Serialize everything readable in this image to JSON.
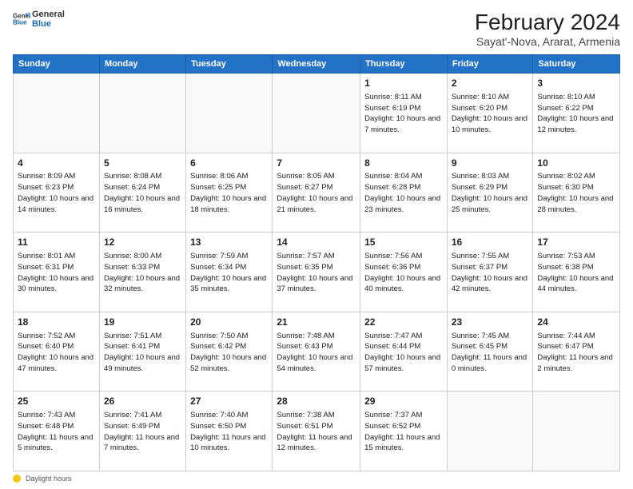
{
  "logo": {
    "general": "General",
    "blue": "Blue"
  },
  "header": {
    "month_year": "February 2024",
    "location": "Sayat'-Nova, Ararat, Armenia"
  },
  "days_of_week": [
    "Sunday",
    "Monday",
    "Tuesday",
    "Wednesday",
    "Thursday",
    "Friday",
    "Saturday"
  ],
  "footer": {
    "label": "Daylight hours"
  },
  "weeks": [
    [
      {
        "day": "",
        "info": ""
      },
      {
        "day": "",
        "info": ""
      },
      {
        "day": "",
        "info": ""
      },
      {
        "day": "",
        "info": ""
      },
      {
        "day": "1",
        "info": "Sunrise: 8:11 AM\nSunset: 6:19 PM\nDaylight: 10 hours and 7 minutes."
      },
      {
        "day": "2",
        "info": "Sunrise: 8:10 AM\nSunset: 6:20 PM\nDaylight: 10 hours and 10 minutes."
      },
      {
        "day": "3",
        "info": "Sunrise: 8:10 AM\nSunset: 6:22 PM\nDaylight: 10 hours and 12 minutes."
      }
    ],
    [
      {
        "day": "4",
        "info": "Sunrise: 8:09 AM\nSunset: 6:23 PM\nDaylight: 10 hours and 14 minutes."
      },
      {
        "day": "5",
        "info": "Sunrise: 8:08 AM\nSunset: 6:24 PM\nDaylight: 10 hours and 16 minutes."
      },
      {
        "day": "6",
        "info": "Sunrise: 8:06 AM\nSunset: 6:25 PM\nDaylight: 10 hours and 18 minutes."
      },
      {
        "day": "7",
        "info": "Sunrise: 8:05 AM\nSunset: 6:27 PM\nDaylight: 10 hours and 21 minutes."
      },
      {
        "day": "8",
        "info": "Sunrise: 8:04 AM\nSunset: 6:28 PM\nDaylight: 10 hours and 23 minutes."
      },
      {
        "day": "9",
        "info": "Sunrise: 8:03 AM\nSunset: 6:29 PM\nDaylight: 10 hours and 25 minutes."
      },
      {
        "day": "10",
        "info": "Sunrise: 8:02 AM\nSunset: 6:30 PM\nDaylight: 10 hours and 28 minutes."
      }
    ],
    [
      {
        "day": "11",
        "info": "Sunrise: 8:01 AM\nSunset: 6:31 PM\nDaylight: 10 hours and 30 minutes."
      },
      {
        "day": "12",
        "info": "Sunrise: 8:00 AM\nSunset: 6:33 PM\nDaylight: 10 hours and 32 minutes."
      },
      {
        "day": "13",
        "info": "Sunrise: 7:59 AM\nSunset: 6:34 PM\nDaylight: 10 hours and 35 minutes."
      },
      {
        "day": "14",
        "info": "Sunrise: 7:57 AM\nSunset: 6:35 PM\nDaylight: 10 hours and 37 minutes."
      },
      {
        "day": "15",
        "info": "Sunrise: 7:56 AM\nSunset: 6:36 PM\nDaylight: 10 hours and 40 minutes."
      },
      {
        "day": "16",
        "info": "Sunrise: 7:55 AM\nSunset: 6:37 PM\nDaylight: 10 hours and 42 minutes."
      },
      {
        "day": "17",
        "info": "Sunrise: 7:53 AM\nSunset: 6:38 PM\nDaylight: 10 hours and 44 minutes."
      }
    ],
    [
      {
        "day": "18",
        "info": "Sunrise: 7:52 AM\nSunset: 6:40 PM\nDaylight: 10 hours and 47 minutes."
      },
      {
        "day": "19",
        "info": "Sunrise: 7:51 AM\nSunset: 6:41 PM\nDaylight: 10 hours and 49 minutes."
      },
      {
        "day": "20",
        "info": "Sunrise: 7:50 AM\nSunset: 6:42 PM\nDaylight: 10 hours and 52 minutes."
      },
      {
        "day": "21",
        "info": "Sunrise: 7:48 AM\nSunset: 6:43 PM\nDaylight: 10 hours and 54 minutes."
      },
      {
        "day": "22",
        "info": "Sunrise: 7:47 AM\nSunset: 6:44 PM\nDaylight: 10 hours and 57 minutes."
      },
      {
        "day": "23",
        "info": "Sunrise: 7:45 AM\nSunset: 6:45 PM\nDaylight: 11 hours and 0 minutes."
      },
      {
        "day": "24",
        "info": "Sunrise: 7:44 AM\nSunset: 6:47 PM\nDaylight: 11 hours and 2 minutes."
      }
    ],
    [
      {
        "day": "25",
        "info": "Sunrise: 7:43 AM\nSunset: 6:48 PM\nDaylight: 11 hours and 5 minutes."
      },
      {
        "day": "26",
        "info": "Sunrise: 7:41 AM\nSunset: 6:49 PM\nDaylight: 11 hours and 7 minutes."
      },
      {
        "day": "27",
        "info": "Sunrise: 7:40 AM\nSunset: 6:50 PM\nDaylight: 11 hours and 10 minutes."
      },
      {
        "day": "28",
        "info": "Sunrise: 7:38 AM\nSunset: 6:51 PM\nDaylight: 11 hours and 12 minutes."
      },
      {
        "day": "29",
        "info": "Sunrise: 7:37 AM\nSunset: 6:52 PM\nDaylight: 11 hours and 15 minutes."
      },
      {
        "day": "",
        "info": ""
      },
      {
        "day": "",
        "info": ""
      }
    ]
  ]
}
